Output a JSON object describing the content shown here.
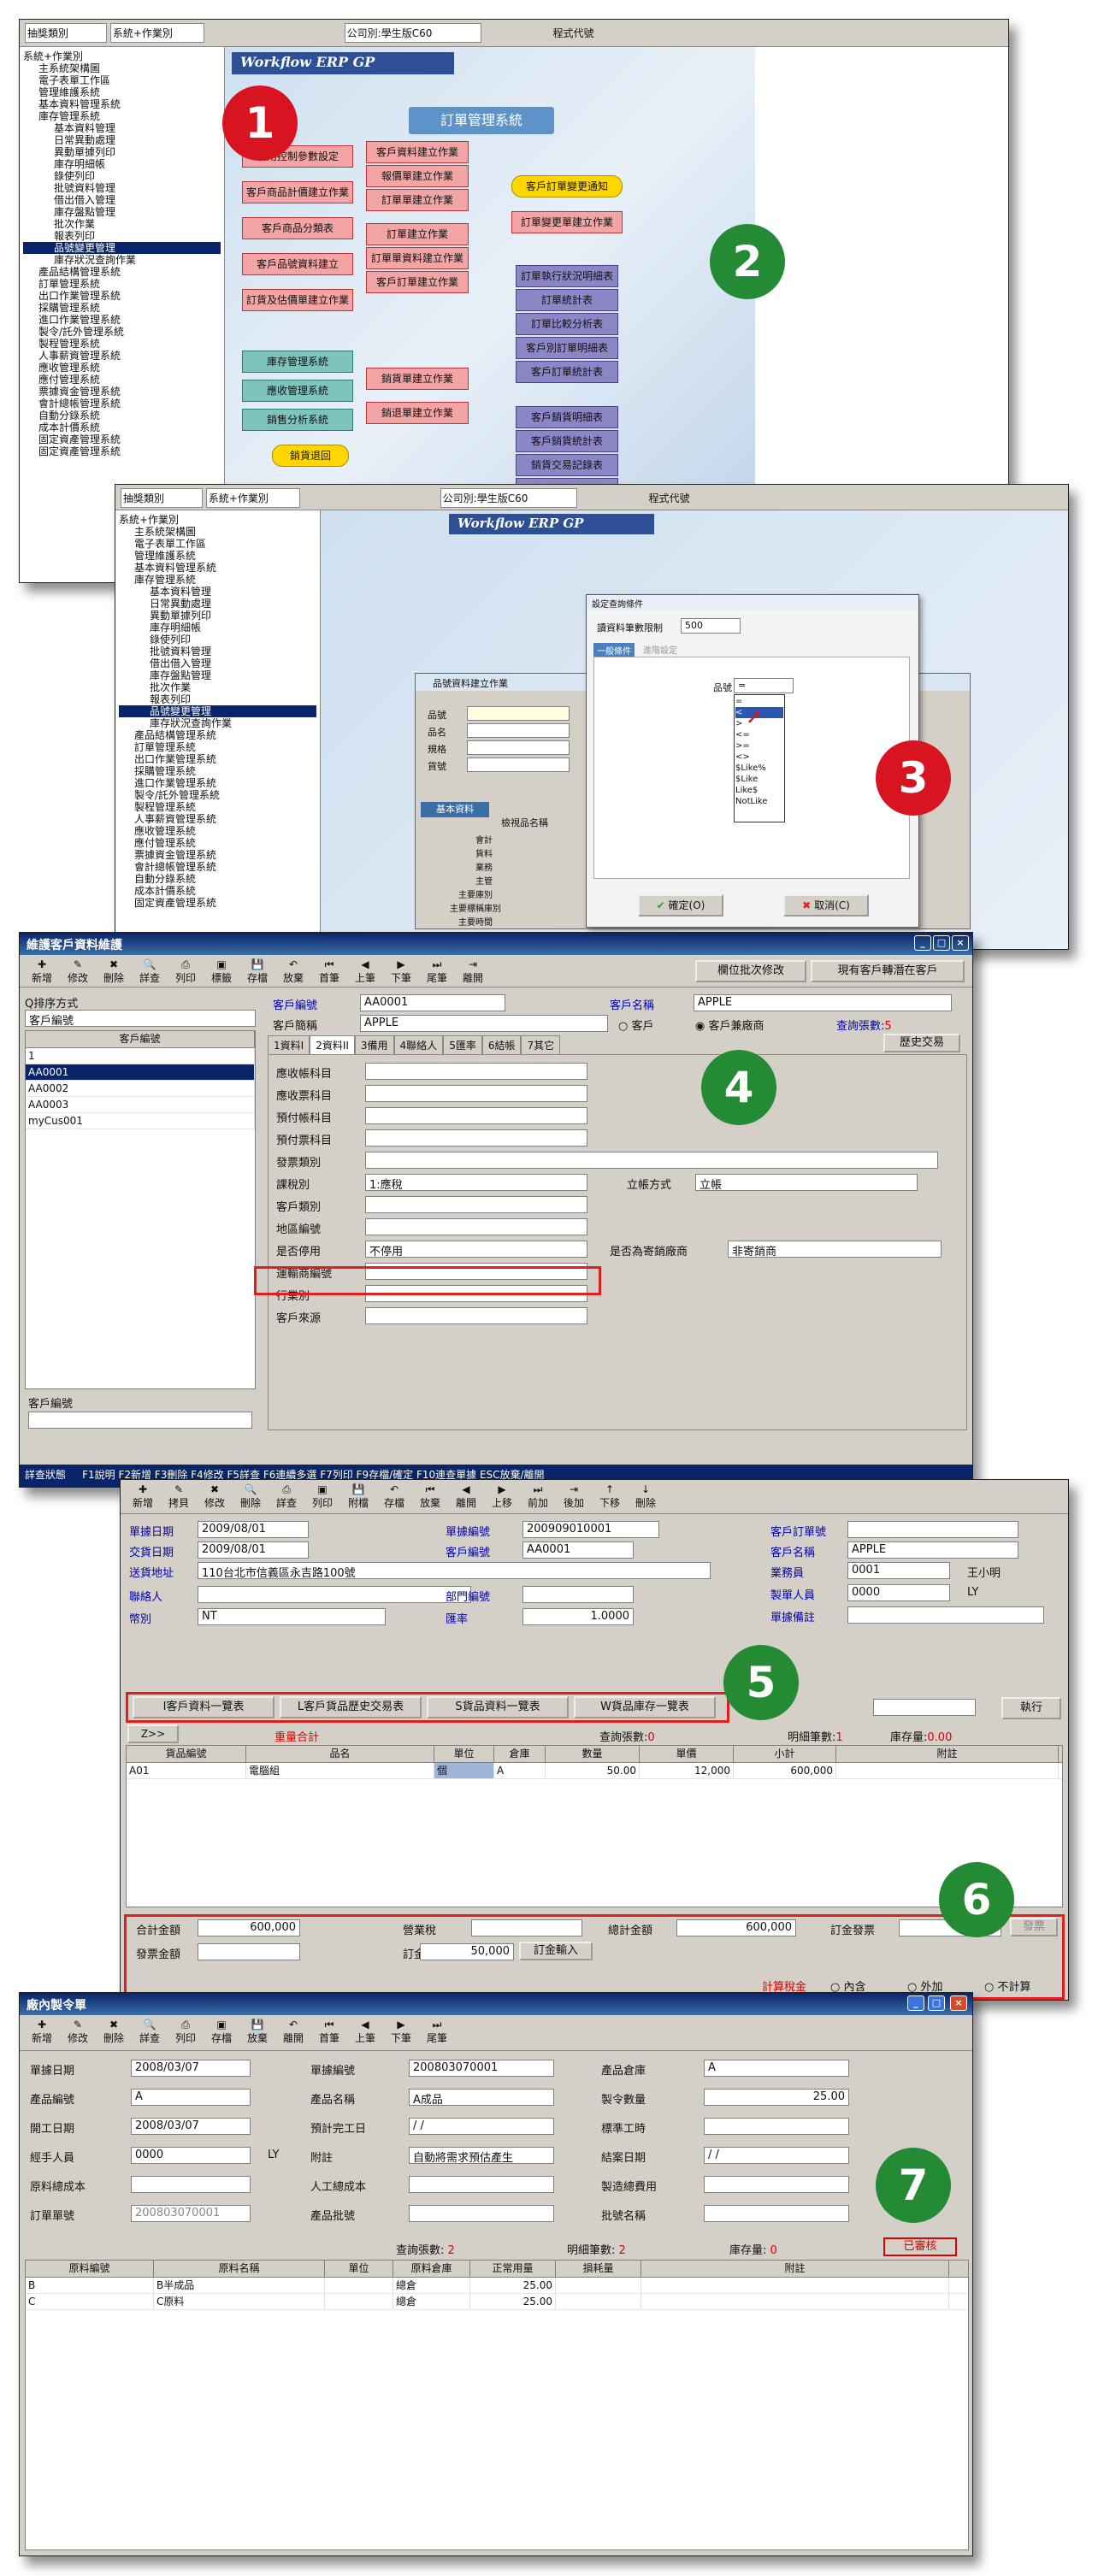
{
  "badges": [
    "1",
    "2",
    "3",
    "4",
    "5",
    "6",
    "7"
  ],
  "s1": {
    "menu": [
      "抽獎類別",
      "系統+作業別"
    ],
    "company": "公司別:學生版C60",
    "app_button": "程式代號",
    "banner": "Workflow ERP GP",
    "tree_items": [
      "系統+作業別",
      "主系統架構圖",
      "電子表單工作區",
      "管理維護系統",
      "基本資料管理系統",
      "庫存管理系統",
      "基本資料管理",
      "日常異動處理",
      "異動單據列印",
      "庫存明細帳",
      "錄使列印",
      "批號資料管理",
      "借出借入管理",
      "庫存盤點管理",
      "批次作業",
      "報表列印",
      "品號變更管理",
      "庫存狀況查詢作業",
      "產品結構管理系統",
      "訂單管理系統",
      "出口作業管理系統",
      "採購管理系統",
      "進口作業管理系統",
      "製令/託外管理系統",
      "製程管理系統",
      "人事薪資管理系統",
      "應收管理系統",
      "應付管理系統",
      "票據資金管理系統",
      "會計總帳管理系統",
      "自動分錄系統",
      "成本計價系統",
      "固定資產管理系統",
      "固定資產管理系統"
    ],
    "diagram": {
      "title": "訂單管理系統",
      "left": [
        "信用控制參數設定",
        "客戶商品計價建立作業",
        "客戶商品分類表",
        "客戶品號資料建立",
        "訂貨及估價單建立作業"
      ],
      "mid1": [
        "客戶資料建立作業",
        "報價單建立作業",
        "訂單單建立作業",
        "訂單建立作業",
        "訂單單資料建立作業",
        "客戶訂單建立作業"
      ],
      "right_top": [
        "客戶訂單變更通知",
        "訂單變更單建立作業"
      ],
      "purple1": [
        "訂單執行狀況明細表",
        "訂單統計表",
        "訂單比較分析表",
        "客戶別訂單明細表",
        "客戶訂單統計表"
      ],
      "teal": [
        "庫存管理系統",
        "應收管理系統",
        "銷售分析系統"
      ],
      "mid2": [
        "銷貨單建立作業",
        "銷退單建立作業"
      ],
      "purple2": [
        "客戶銷貨明細表",
        "客戶銷貨統計表",
        "銷貨交易記錄表",
        "客戶銷貨彙總表"
      ],
      "yellow": "銷貨退回"
    }
  },
  "s3": {
    "menu": [
      "抽獎類別",
      "系統+作業別"
    ],
    "company": "公司別:學生版C60",
    "app_button": "程式代號",
    "banner": "Workflow ERP GP",
    "dialog_title": "設定查詢條件",
    "dialog_label": "讀資料筆數限制",
    "dialog_value": "500",
    "dialog_tabs": [
      "一般條件",
      "進階設定"
    ],
    "field_label": "品號",
    "field_value": "=",
    "options": [
      "=",
      "<",
      ">",
      "<=",
      ">=",
      "<>",
      "$Like%",
      "$Like",
      "Like$",
      "NotLike"
    ],
    "ok": "確定(O)",
    "cancel": "取消(C)",
    "back_title": "品號資料建立作業",
    "back_labels": [
      "品號",
      "品名",
      "規格",
      "貨號"
    ],
    "back_tab": "基本資料",
    "back_col": "檢視品名稱",
    "back_bottom": [
      "會計",
      "貨料",
      "業務",
      "主管",
      "主要庫別",
      "主要標稱庫別",
      "主要時間"
    ]
  },
  "s4": {
    "title": "維護客戶資料維護",
    "toolbar": [
      "新增",
      "修改",
      "刪除",
      "詳查",
      "列印",
      "標籤",
      "存檔",
      "放棄",
      "首筆",
      "上筆",
      "下筆",
      "尾筆",
      "離開"
    ],
    "right_buttons": [
      "欄位批次修改",
      "現有客戶轉潛在客戶"
    ],
    "sort_label": "Q排序方式",
    "sort_value": "客戶編號",
    "list_header": "客戶編號",
    "list_rows": [
      "1",
      "AA0001",
      "AA0002",
      "AA0003",
      "myCus001"
    ],
    "search_label": "客戶編號",
    "cust_no_label": "客戶編號",
    "cust_no": "AA0001",
    "cust_name_label": "客戶名稱",
    "cust_name": "APPLE",
    "short_label": "客戶簡稱",
    "short_name": "APPLE",
    "radio_a": "客戶",
    "radio_b": "客戶兼廠商",
    "count_label": "查詢張數:",
    "count": "5",
    "tabs": [
      "1資料I",
      "2資料II",
      "3備用",
      "4聯絡人",
      "5匯率",
      "6結帳",
      "7其它"
    ],
    "history": "歷史交易",
    "form_labels": [
      "應收帳科目",
      "應收票科目",
      "預付帳科目",
      "預付票科目",
      "發票類別",
      "課稅別",
      "客戶類別",
      "地區編號",
      "是否停用",
      "運輸商編號",
      "行業別",
      "客戶來源"
    ],
    "tax_value": "1:應稅",
    "settle_label": "立帳方式",
    "settle_value": "立帳",
    "stop_value": "不停用",
    "consign_label": "是否為寄銷廠商",
    "consign_value": "非寄銷商",
    "status": "詳查狀態",
    "status_hint": "F1說明 F2新增 F3刪除 F4修改 F5詳查 F6連續多選 F7列印 F9存檔/確定 F10連查單據 ESC放棄/離開"
  },
  "s5": {
    "toolbar": [
      "新增",
      "拷貝",
      "修改",
      "刪除",
      "詳查",
      "列印",
      "附檔",
      "存檔",
      "放棄",
      "離開",
      "上移",
      "前加",
      "後加",
      "下移",
      "刪除"
    ],
    "labels": [
      "單據日期",
      "交貨日期",
      "送貨地址",
      "聯絡人",
      "幣別",
      "單據編號",
      "客戶編號",
      "部門編號",
      "匯率",
      "客戶訂單號",
      "客戶名稱",
      "業務員",
      "製單人員",
      "單據備註"
    ],
    "doc_date": "2009/08/01",
    "ship_date": "2009/08/01",
    "address": "110台北市信義區永吉路100號",
    "currency": "NT",
    "doc_no": "200909010001",
    "cust_no": "AA0001",
    "rate": "1.0000",
    "cust_name": "APPLE",
    "sales": "0001",
    "sales_name": "王小明",
    "maker": "0000",
    "maker_name": "LY",
    "tabs_btn": [
      "I客戶資料一覽表",
      "L客戶貨品歷史交易表",
      "S貨品資料一覽表",
      "W貨品庫存一覽表"
    ],
    "exec": "執行",
    "zbtn": "Z>>",
    "sum_label": "重量合計",
    "count_label": "查詢張數:",
    "count": "0",
    "detail_label": "明細筆數:",
    "detail": "1",
    "stock_label": "庫存量:",
    "stock": "0.00",
    "grid_headers": [
      "貨品編號",
      "品名",
      "單位",
      "倉庫",
      "數量",
      "單價",
      "小計",
      "附註"
    ],
    "grid_row": [
      "A01",
      "電腦組",
      "個",
      "A",
      "50.00",
      "12,000",
      "600,000",
      ""
    ],
    "total_label": "合計金額",
    "total": "600,000",
    "tax_label": "營業稅",
    "tax": "",
    "grand_label": "總計金額",
    "grand": "600,000",
    "deposit_label": "訂金發票",
    "deposit_btn": "發票",
    "invoice_label": "發票金額",
    "dep_label": "訂金",
    "dep": "50,000",
    "dep_btn": "訂金輸入",
    "tax_method": "計算稅金",
    "tax_opts": [
      "內含",
      "外加",
      "不計算"
    ]
  },
  "s7": {
    "title": "廠內製令單",
    "toolbar": [
      "新增",
      "修改",
      "刪除",
      "詳查",
      "列印",
      "存檔",
      "放棄",
      "離開",
      "首筆",
      "上筆",
      "下筆",
      "尾筆"
    ],
    "labels_l": [
      "單據日期",
      "產品編號",
      "開工日期",
      "經手人員",
      "原料總成本",
      "訂單單號"
    ],
    "vals_l": [
      "2008/03/07",
      "A",
      "2008/03/07",
      "0000",
      "",
      "200803070001"
    ],
    "maker_name": "LY",
    "labels_m": [
      "單據編號",
      "產品名稱",
      "預計完工日",
      "附註",
      "人工總成本",
      "產品批號"
    ],
    "vals_m": [
      "200803070001",
      "A成品",
      "/ /",
      "自動將需求預估產生",
      "",
      ""
    ],
    "labels_r": [
      "產品倉庫",
      "製令數量",
      "標準工時",
      "結案日期",
      "製造總費用",
      "批號名稱"
    ],
    "vals_r": [
      "A",
      "25.00",
      "",
      "/ /",
      "",
      ""
    ],
    "count_label": "查詢張數:",
    "count": "2",
    "detail_label": "明細筆數:",
    "detail": "2",
    "stock_label": "庫存量:",
    "stock": "0",
    "approved": "已審核",
    "grid_headers": [
      "原料編號",
      "原料名稱",
      "單位",
      "原料倉庫",
      "正常用量",
      "損耗量",
      "附註"
    ],
    "rows": [
      [
        "B",
        "B半成品",
        "",
        "總倉",
        "25.00",
        "",
        ""
      ],
      [
        "C",
        "C原料",
        "",
        "總倉",
        "25.00",
        "",
        ""
      ]
    ]
  }
}
